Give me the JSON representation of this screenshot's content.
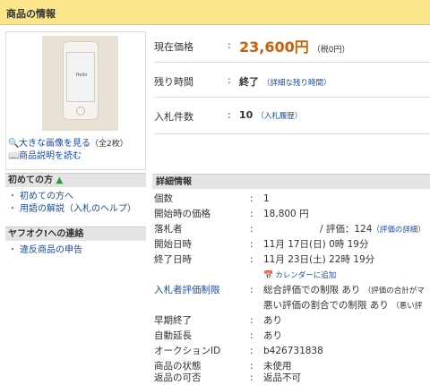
{
  "header": {
    "title": "商品の情報"
  },
  "image_panel": {
    "phone_screen_text": "Hello",
    "enlarge_link": "大きな画像を見る",
    "enlarge_count": "（全2枚）",
    "description_link": "商品説明を読む"
  },
  "beginner": {
    "heading": "初めての方",
    "items": [
      "初めての方へ",
      "用語の解説（入札のヘルプ）"
    ]
  },
  "report": {
    "heading": "ヤフオク!への連絡",
    "items": [
      "違反商品の申告"
    ]
  },
  "summary": {
    "price_label": "現在価格",
    "price_value": "23,600円",
    "price_tax": "（税0円）",
    "time_label": "残り時間",
    "time_value": "終了",
    "time_link": "（詳細な残り時間）",
    "bids_label": "入札件数",
    "bids_value": "10",
    "bids_link": "（入札履歴）"
  },
  "details": {
    "heading": "詳細情報",
    "rows": [
      {
        "label": "個数",
        "value": "1"
      },
      {
        "label": "開始時の価格",
        "value": "18,800 円"
      },
      {
        "label": "落札者",
        "value": "/ 評価：124",
        "extra": "（評価の詳細）"
      },
      {
        "label": "開始日時",
        "value": "11月 17日(日) 0時 19分"
      },
      {
        "label": "終了日時",
        "value": "11月 23日(土) 22時 19分"
      },
      {
        "label": "",
        "value": "カレンダーに追加"
      },
      {
        "label": "入札者評価制限",
        "value": "総合評価での制限 あり",
        "extra": "（評価の合計がマ"
      },
      {
        "label": "",
        "value": "悪い評価の割合での制限 あり",
        "extra": "（悪い評"
      },
      {
        "label": "早期終了",
        "value": "あり"
      },
      {
        "label": "自動延長",
        "value": "あり"
      },
      {
        "label": "オークションID",
        "value": "b426731838"
      },
      {
        "label": "商品の状態",
        "value": "未使用"
      },
      {
        "label": "返品の可否",
        "value": "返品不可"
      }
    ]
  },
  "colors": {
    "accent_price": "#cc5f0a",
    "link": "#1a4ba5",
    "header_bg": "#fbe58b"
  }
}
